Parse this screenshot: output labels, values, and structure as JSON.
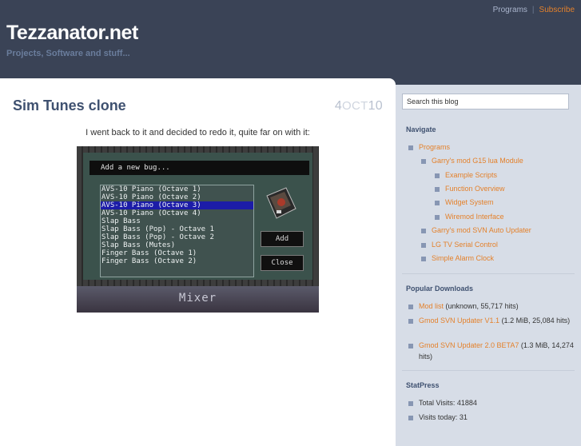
{
  "header": {
    "links": [
      "Programs",
      "Subscribe"
    ],
    "title": "Tezzanator.net",
    "tagline": "Projects, Software and stuff..."
  },
  "post": {
    "title": "Sim Tunes clone",
    "date_day": "4",
    "date_month": "OCT",
    "date_year": "10",
    "text": "I went back to it and decided to redo it, quite far on with it:",
    "screenshot": {
      "dialog_title": "Add a new bug...",
      "items": [
        "AVS-10 Piano (Octave 1)",
        "AVS-10 Piano (Octave 2)",
        "AVS-10 Piano (Octave 3)",
        "AVS-10 Piano (Octave 4)",
        "Slap Bass",
        "Slap Bass (Pop) - Octave 1",
        "Slap Bass (Pop) - Octave 2",
        "Slap Bass (Mutes)",
        "Finger Bass (Octave 1)",
        "Finger Bass (Octave 2)"
      ],
      "selected_index": 2,
      "add_label": "Add",
      "close_label": "Close",
      "mixer_label": "Mixer"
    }
  },
  "sidebar": {
    "search_placeholder": "Search this blog",
    "navigate_heading": "Navigate",
    "nav": [
      {
        "label": "Programs",
        "level": 0
      },
      {
        "label": "Garry's mod G15 lua Module",
        "level": 1
      },
      {
        "label": "Example Scripts",
        "level": 2
      },
      {
        "label": "Function Overview",
        "level": 2
      },
      {
        "label": "Widget System",
        "level": 2
      },
      {
        "label": "Wiremod Interface",
        "level": 2
      },
      {
        "label": "Garry's mod SVN Auto Updater",
        "level": 1
      },
      {
        "label": "LG TV Serial Control",
        "level": 1
      },
      {
        "label": "Simple Alarm Clock",
        "level": 1
      }
    ],
    "downloads_heading": "Popular Downloads",
    "downloads": [
      {
        "link": "Mod list",
        "info": " (unknown, 55,717 hits)"
      },
      {
        "link": "Gmod SVN Updater V1.1",
        "info": " (1.2 MiB, 25,084 hits)"
      },
      {
        "link": "Gmod SVN Updater 2.0 BETA7",
        "info": " (1.3 MiB, 14,274 hits)"
      }
    ],
    "statpress_heading": "StatPress",
    "stats": [
      "Total Visits: 41884",
      "Visits today: 31"
    ]
  }
}
